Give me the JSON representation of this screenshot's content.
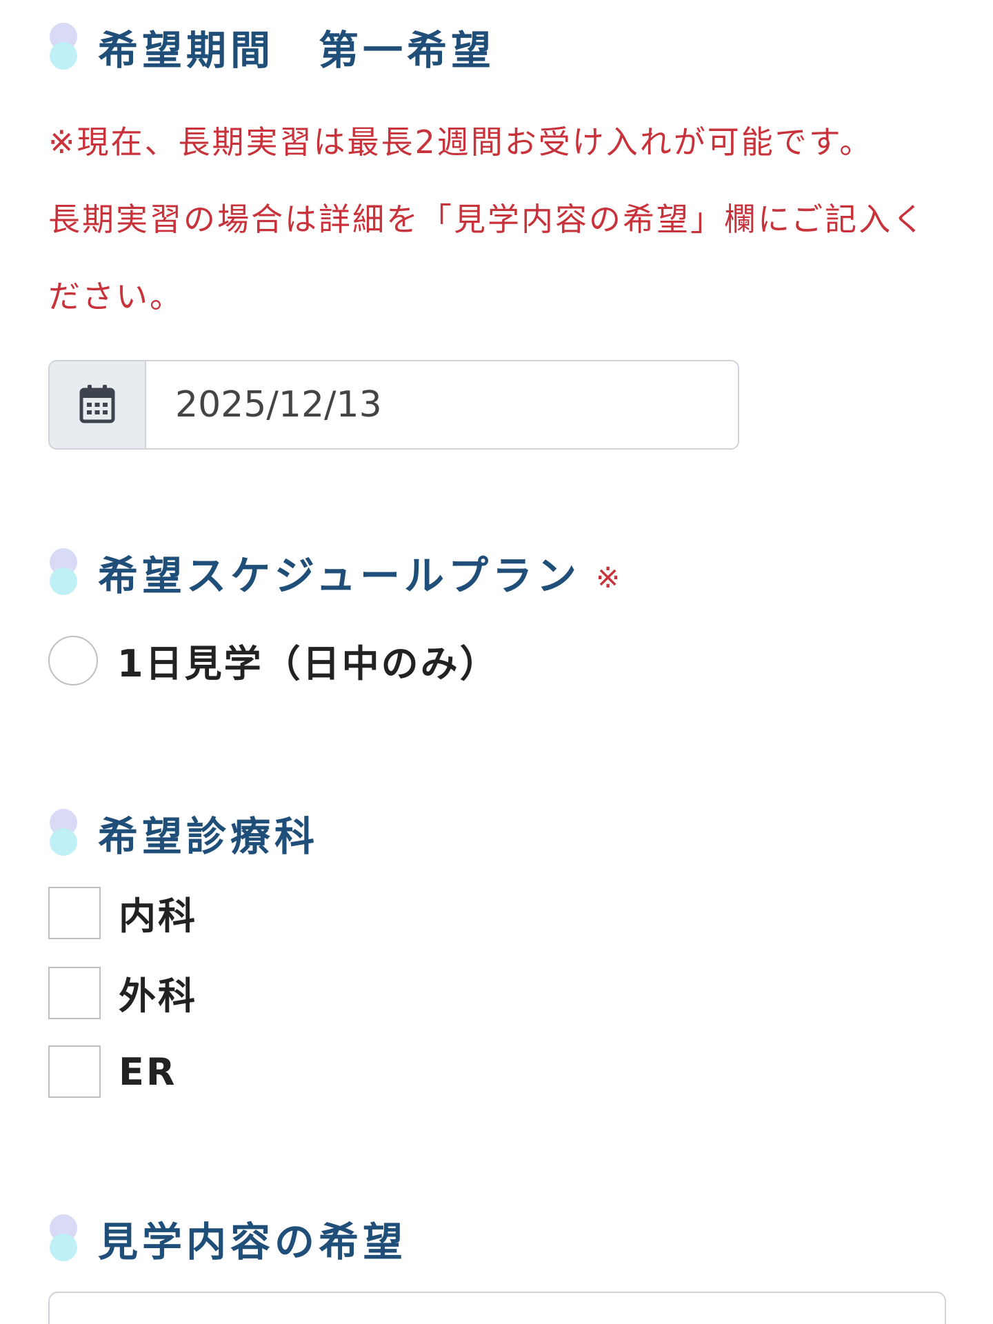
{
  "period": {
    "heading": "希望期間　第一希望",
    "notice_line1": "※現在、長期実習は最長2週間お受け入れが可能です。",
    "notice_line2": "長期実習の場合は詳細を「見学内容の希望」欄にご記入く",
    "notice_line3": "ださい。",
    "calendar_icon": "calendar-icon",
    "date_value": "2025/12/13"
  },
  "schedule": {
    "heading": "希望スケジュールプラン",
    "required_mark": "※",
    "options": [
      {
        "label": "1日見学（日中のみ）",
        "selected": false
      }
    ]
  },
  "department": {
    "heading": "希望診療科",
    "options": [
      {
        "label": "内科",
        "checked": false
      },
      {
        "label": "外科",
        "checked": false
      },
      {
        "label": "ER",
        "checked": false
      }
    ]
  },
  "content": {
    "heading": "見学内容の希望",
    "value": ""
  },
  "colors": {
    "heading": "#1f4e79",
    "notice": "#c8323a",
    "dot_top": "#d8daf6",
    "dot_bottom": "#bff0f6"
  }
}
